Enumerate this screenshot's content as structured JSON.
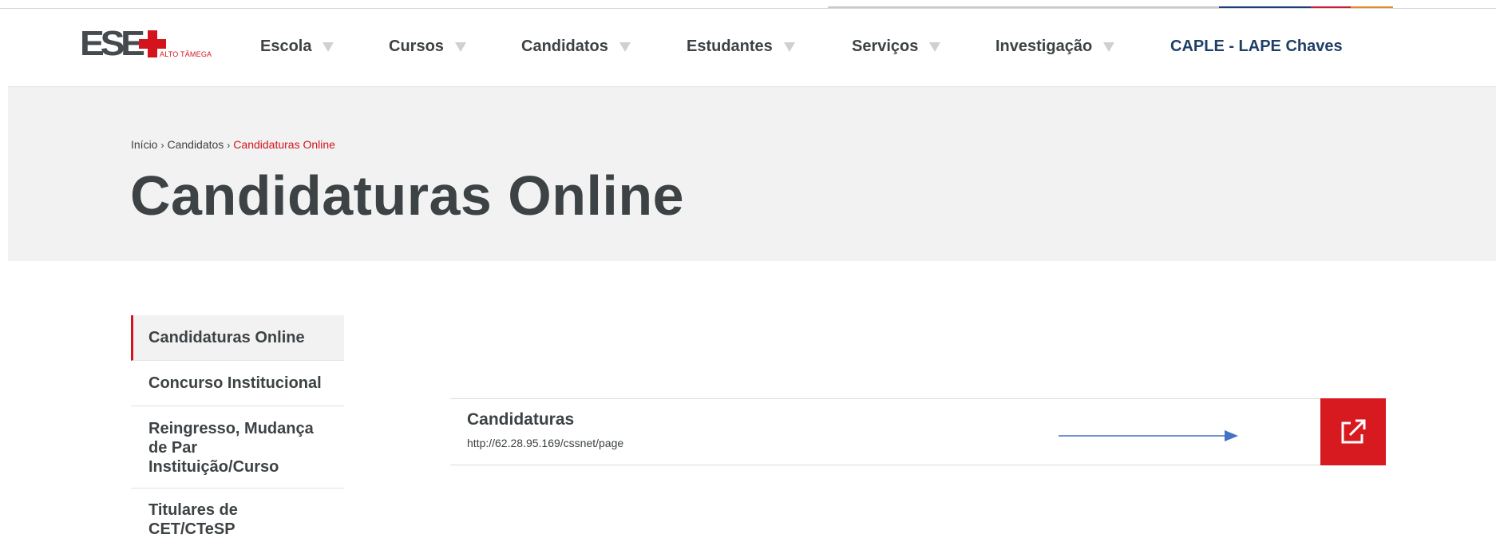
{
  "logo": {
    "main_text": "ESE",
    "sub_text": "ALTO TÂMEGA"
  },
  "nav": {
    "items": [
      {
        "label": "Escola",
        "has_dropdown": true
      },
      {
        "label": "Cursos",
        "has_dropdown": true
      },
      {
        "label": "Candidatos",
        "has_dropdown": true
      },
      {
        "label": "Estudantes",
        "has_dropdown": true
      },
      {
        "label": "Serviços",
        "has_dropdown": true
      },
      {
        "label": "Investigação",
        "has_dropdown": true
      },
      {
        "label": "CAPLE - LAPE Chaves",
        "has_dropdown": false
      }
    ]
  },
  "breadcrumb": {
    "home": "Início",
    "parent": "Candidatos",
    "current": "Candidaturas Online",
    "separator": "›"
  },
  "page": {
    "title": "Candidaturas Online"
  },
  "sidebar": {
    "items": [
      {
        "label": "Candidaturas Online",
        "active": true
      },
      {
        "label": "Concurso Institucional",
        "active": false
      },
      {
        "label": "Reingresso, Mudança de Par Instituição/Curso",
        "active": false
      },
      {
        "label": "Titulares de CET/CTeSP",
        "active": false
      }
    ]
  },
  "link_card": {
    "title": "Candidaturas",
    "url": "http://62.28.95.169/cssnet/page",
    "button_icon": "external-link-icon"
  },
  "colors": {
    "accent_red": "#d71920",
    "text_dark": "#3d4245",
    "caple_blue": "#1f3f66",
    "hero_bg": "#f2f2f2",
    "arrow_blue": "#4472c4"
  }
}
